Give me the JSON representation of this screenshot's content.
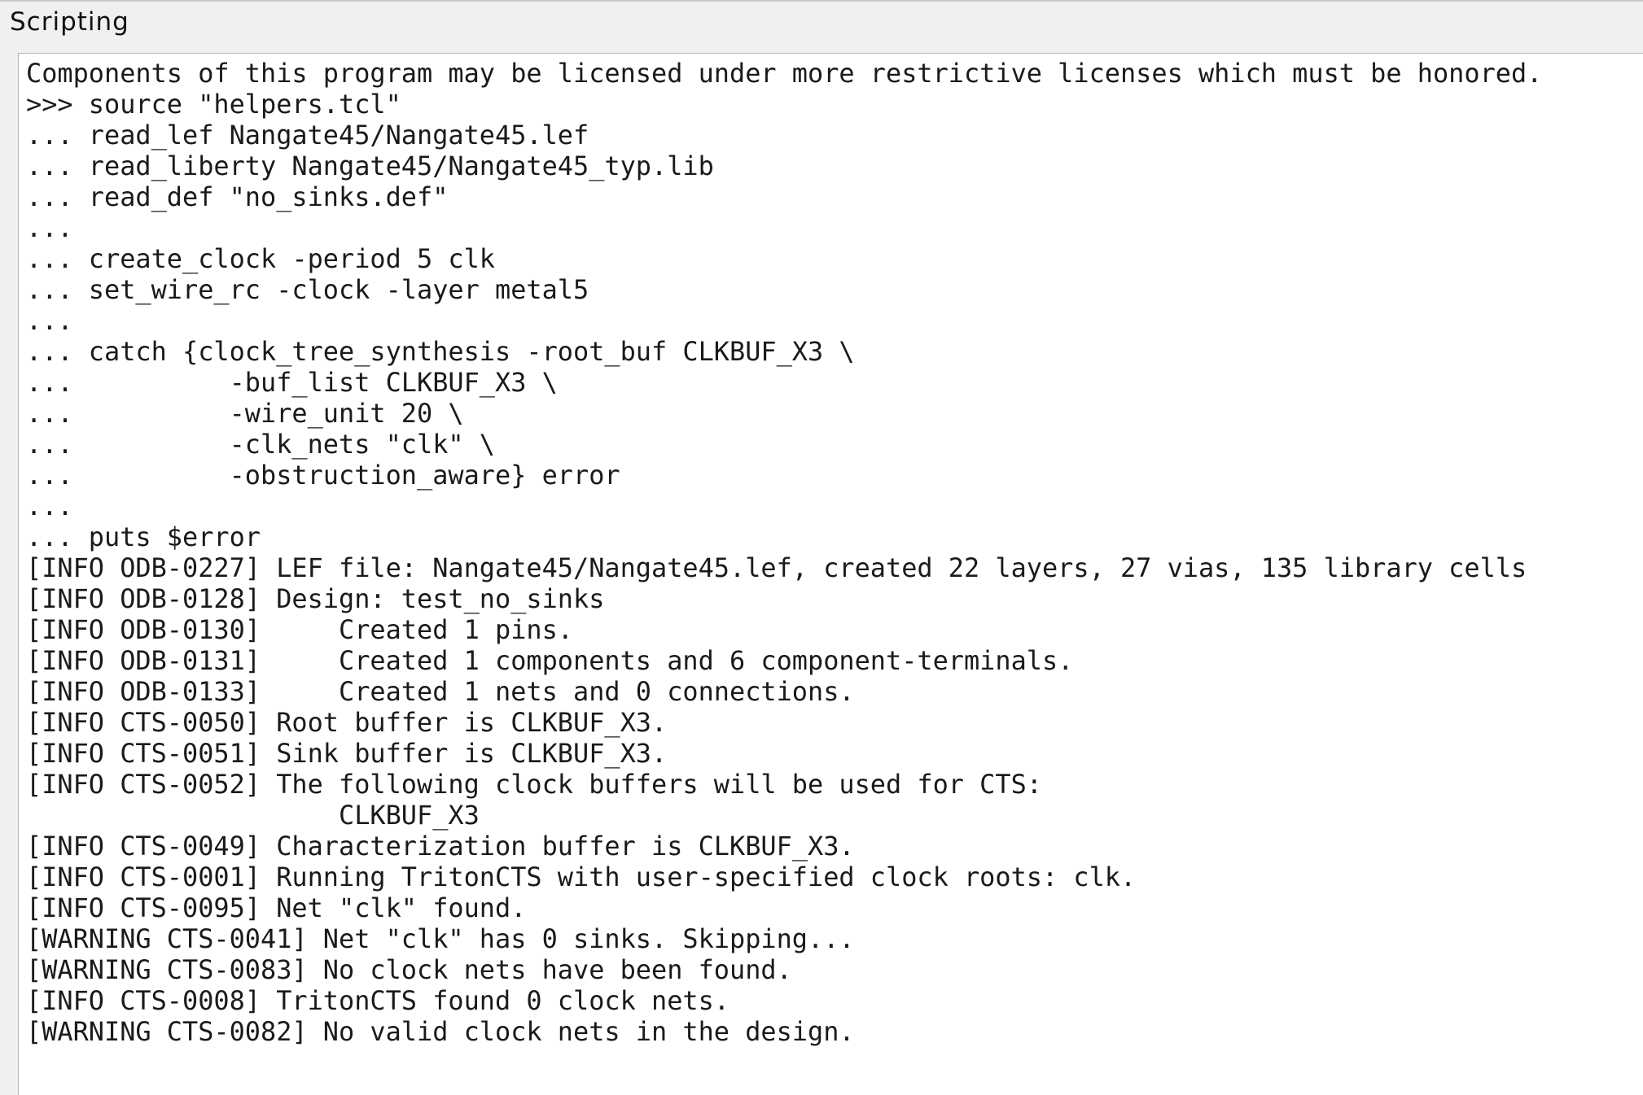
{
  "window": {
    "title": "Scripting"
  },
  "console": {
    "lines": [
      "Components of this program may be licensed under more restrictive licenses which must be honored.",
      ">>> source \"helpers.tcl\"",
      "... read_lef Nangate45/Nangate45.lef",
      "... read_liberty Nangate45/Nangate45_typ.lib",
      "... read_def \"no_sinks.def\"",
      "...",
      "... create_clock -period 5 clk",
      "... set_wire_rc -clock -layer metal5",
      "...",
      "... catch {clock_tree_synthesis -root_buf CLKBUF_X3 \\",
      "...          -buf_list CLKBUF_X3 \\",
      "...          -wire_unit 20 \\",
      "...          -clk_nets \"clk\" \\",
      "...          -obstruction_aware} error",
      "...",
      "... puts $error",
      "[INFO ODB-0227] LEF file: Nangate45/Nangate45.lef, created 22 layers, 27 vias, 135 library cells",
      "[INFO ODB-0128] Design: test_no_sinks",
      "[INFO ODB-0130]     Created 1 pins.",
      "[INFO ODB-0131]     Created 1 components and 6 component-terminals.",
      "[INFO ODB-0133]     Created 1 nets and 0 connections.",
      "[INFO CTS-0050] Root buffer is CLKBUF_X3.",
      "[INFO CTS-0051] Sink buffer is CLKBUF_X3.",
      "[INFO CTS-0052] The following clock buffers will be used for CTS:",
      "                    CLKBUF_X3",
      "[INFO CTS-0049] Characterization buffer is CLKBUF_X3.",
      "[INFO CTS-0001] Running TritonCTS with user-specified clock roots: clk.",
      "[INFO CTS-0095] Net \"clk\" found.",
      "[WARNING CTS-0041] Net \"clk\" has 0 sinks. Skipping...",
      "[WARNING CTS-0083] No clock nets have been found.",
      "[INFO CTS-0008] TritonCTS found 0 clock nets.",
      "[WARNING CTS-0082] No valid clock nets in the design."
    ]
  }
}
